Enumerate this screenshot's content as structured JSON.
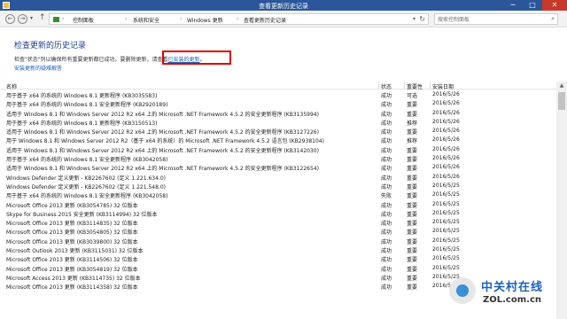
{
  "window": {
    "title": "查看更新历史记录",
    "minimize": "─",
    "maximize": "□",
    "close": "✕"
  },
  "nav": {
    "back": "←",
    "forward": "→",
    "recent": "▾",
    "up": "↑",
    "breadcrumbs": [
      "控制面板",
      "系统和安全",
      "Windows 更新",
      "查看更新历史记录"
    ],
    "separator": "›",
    "dropdown": "▾",
    "refresh": "↻",
    "search_placeholder": "搜索控制面板",
    "search_glyph": "⌕"
  },
  "page": {
    "title": "检查更新的历史记录",
    "desc_before": "检查\"状态\"列以确保所有重要更新都已成功。要删除更新，",
    "desc_mid": "请查看",
    "desc_link": "已安装的更新",
    "desc_after": "。",
    "help_link": "安装更新的疑难解答"
  },
  "table": {
    "headers": {
      "name": "名称",
      "status": "状态",
      "importance": "重要性",
      "date": "安装日期"
    },
    "rows": [
      {
        "name": "用于基于 x64 的系统的 Windows 8.1 更新程序 (KB3035583)",
        "status": "成功",
        "importance": "可选",
        "date": "2016/5/26"
      },
      {
        "name": "用于基于 x64 的系统的 Windows 8.1 安全更新程序 (KB2920189)",
        "status": "成功",
        "importance": "重要",
        "date": "2016/5/26"
      },
      {
        "name": "适用于 Windows 8.1 和 Windows Server 2012 R2 x64 上的 Microsoft .NET Framework 4.5.2 的安全更新程序 (KB3135994)",
        "status": "成功",
        "importance": "重要",
        "date": "2016/5/26"
      },
      {
        "name": "用于基于 x64 的系统的 Windows 8.1 更新程序 (KB3150513)",
        "status": "成功",
        "importance": "推荐",
        "date": "2016/5/26"
      },
      {
        "name": "适用于 Windows 8.1 和 Windows Server 2012 R2 x64 上的 Microsoft .NET Framework 4.5.2 的安全更新程序 (KB3127226)",
        "status": "成功",
        "importance": "重要",
        "date": "2016/5/26"
      },
      {
        "name": "用于 Windows 8.1 和 Windows Server 2012 R2（基于 x64 的系统）的 Microsoft .NET Framework 4.5.2 语言包 (KB2938104)",
        "status": "成功",
        "importance": "推荐",
        "date": "2016/5/26"
      },
      {
        "name": "适用于 Windows 8.1 和 Windows Server 2012 R2 x64 上的 Microsoft .NET Framework 4.5.2 的安全更新程序 (KB3142030)",
        "status": "成功",
        "importance": "重要",
        "date": "2016/5/26"
      },
      {
        "name": "用于基于 x64 的系统的 Windows 8.1 安全更新程序 (KB3042058)",
        "status": "成功",
        "importance": "重要",
        "date": "2016/5/26"
      },
      {
        "name": "适用于 Windows 8.1 和 Windows Server 2012 R2 x64 上的 Microsoft .NET Framework 4.5.2 的安全更新程序 (KB3122654)",
        "status": "成功",
        "importance": "重要",
        "date": "2016/5/26"
      },
      {
        "name": "Windows Defender 定义更新 - KB2267602 (定义 1.221.634.0)",
        "status": "成功",
        "importance": "重要",
        "date": "2016/5/26"
      },
      {
        "name": "Windows Defender 定义更新 - KB2267602 (定义 1.221.548.0)",
        "status": "成功",
        "importance": "重要",
        "date": "2016/5/25"
      },
      {
        "name": "用于基于 x64 的系统的 Windows 8.1 安全更新程序 (KB3042058)",
        "status": "失败",
        "importance": "重要",
        "date": "2016/5/25"
      },
      {
        "name": "Microsoft Office 2013 更新 (KB3054785) 32 位版本",
        "status": "成功",
        "importance": "重要",
        "date": "2016/5/25"
      },
      {
        "name": "Skype for Business 2015 安全更新 (KB3114994) 32 位版本",
        "status": "成功",
        "importance": "重要",
        "date": "2016/5/25"
      },
      {
        "name": "Microsoft Office 2013 更新 (KB3114835) 32 位版本",
        "status": "成功",
        "importance": "重要",
        "date": "2016/5/25"
      },
      {
        "name": "Microsoft Office 2013 更新 (KB3054805) 32 位版本",
        "status": "成功",
        "importance": "重要",
        "date": "2016/5/25"
      },
      {
        "name": "Microsoft Office 2013 更新 (KB3039800) 32 位版本",
        "status": "成功",
        "importance": "重要",
        "date": "2016/5/25"
      },
      {
        "name": "Microsoft Outlook 2013 更新 (KB3115031) 32 位版本",
        "status": "成功",
        "importance": "重要",
        "date": "2016/5/25"
      },
      {
        "name": "Microsoft Office 2013 更新 (KB3114506) 32 位版本",
        "status": "成功",
        "importance": "重要",
        "date": "2016/5/25"
      },
      {
        "name": "Microsoft Office 2013 更新 (KB3054819) 32 位版本",
        "status": "成功",
        "importance": "重要",
        "date": "2016/5/25"
      },
      {
        "name": "Microsoft Access 2013 更新 (KB3114735) 32 位版本",
        "status": "成功",
        "importance": "重要",
        "date": "2016/5/25"
      },
      {
        "name": "Microsoft Office 2013 更新 (KB3114358) 32 位版本",
        "status": "成功",
        "importance": "重要",
        "date": "2016/5/25"
      }
    ]
  },
  "scrollbar": {
    "up": "▲"
  },
  "watermark": {
    "cn": "中关村在线",
    "en": "ZOL.com.cn"
  },
  "colors": {
    "titlebar": "#2b579a",
    "link": "#1f5fbf",
    "title": "#1e3f8f",
    "highlight": "#e00000"
  }
}
